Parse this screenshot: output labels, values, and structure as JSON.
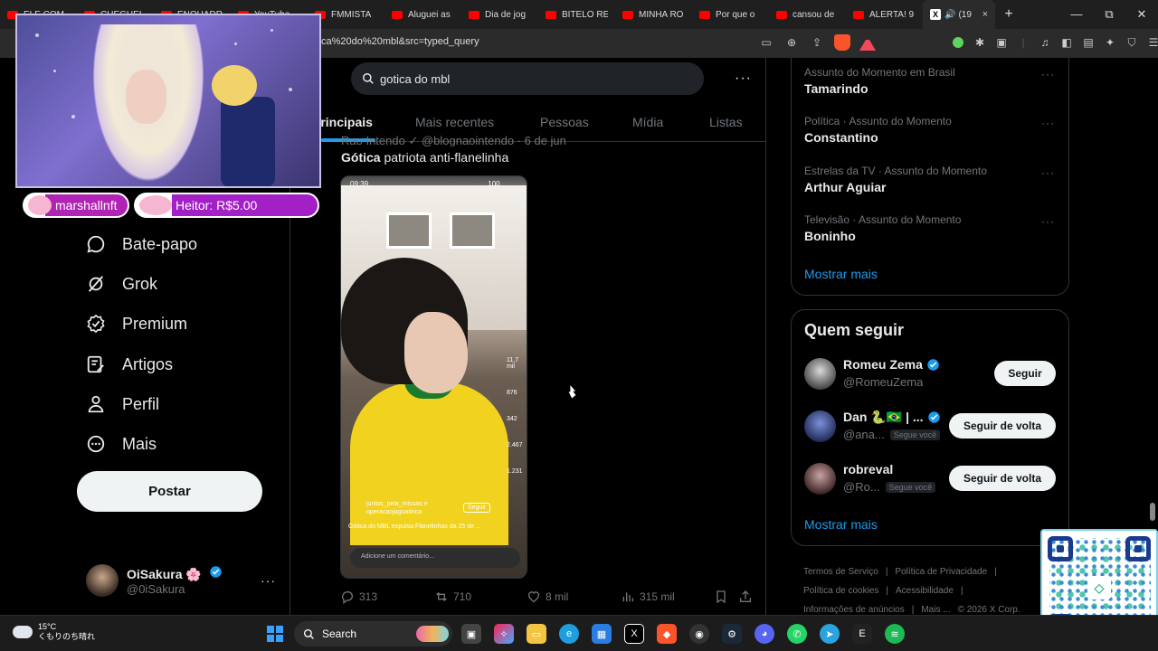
{
  "browser": {
    "tabs": [
      {
        "label": "ELE COM"
      },
      {
        "label": "CHEGUEI"
      },
      {
        "label": "ENQUADR"
      },
      {
        "label": "YouTube"
      },
      {
        "label": "FMMISTA"
      },
      {
        "label": "Aluguei as"
      },
      {
        "label": "Dia de jog"
      },
      {
        "label": "BITELO RE"
      },
      {
        "label": "MINHA RO"
      },
      {
        "label": "Por que o"
      },
      {
        "label": "cansou de"
      },
      {
        "label": "ALERTA! 9"
      }
    ],
    "active_tab": {
      "label": "(19",
      "close": "×"
    },
    "new_tab": "+",
    "window_controls": {
      "minimize": "—",
      "maximize": "⧉",
      "close": "✕"
    },
    "url": "ca%20do%20mbl&src=typed_query"
  },
  "stream_overlay": {
    "donation1": "marshallnft",
    "donation2": "Heitor: R$5.00"
  },
  "sidebar": {
    "items": [
      {
        "label": "Bate-papo",
        "icon": "chat-bubble-icon"
      },
      {
        "label": "Grok",
        "icon": "grok-icon"
      },
      {
        "label": "Premium",
        "icon": "premium-badge-icon"
      },
      {
        "label": "Artigos",
        "icon": "articles-icon"
      },
      {
        "label": "Perfil",
        "icon": "person-icon"
      },
      {
        "label": "Mais",
        "icon": "more-circle-icon"
      }
    ],
    "post_button": "Postar",
    "account": {
      "name": "OiSakura 🌸",
      "handle": "@0iSakura",
      "more": "···"
    }
  },
  "search": {
    "value": "gotica do mbl",
    "more": "···",
    "tabs": [
      {
        "label": "Principais"
      },
      {
        "label": "Mais recentes"
      },
      {
        "label": "Pessoas"
      },
      {
        "label": "Mídia"
      },
      {
        "label": "Listas"
      }
    ]
  },
  "tweet": {
    "header_partial": "Rao Intendo ✓ @blognaointendo · 6 de jun",
    "text_bold": "Gótica",
    "text_rest": " patriota anti-flanelinha",
    "media": {
      "status_time": "09:39",
      "battery": "100",
      "user": "juntos_pela_missao e operacaojaguatirica",
      "follow": "Seguir",
      "caption": "Gótica do MBL expulsa Flanelinhas da 25 de ...",
      "comment_placeholder": "Adicione um comentário...",
      "side_counts": [
        "11,7 mil",
        "876",
        "342",
        "2.467",
        "1.231"
      ]
    },
    "actions": {
      "replies": "313",
      "reposts": "710",
      "likes": "8 mil",
      "views": "315 mil"
    }
  },
  "trends": {
    "items": [
      {
        "meta": "Assunto do Momento em Brasil",
        "name": "Tamarindo"
      },
      {
        "meta": "Política · Assunto do Momento",
        "name": "Constantino"
      },
      {
        "meta": "Estrelas da TV · Assunto do Momento",
        "name": "Arthur Aguiar"
      },
      {
        "meta": "Televisão · Assunto do Momento",
        "name": "Boninho"
      }
    ],
    "show_more": "Mostrar mais"
  },
  "who_to_follow": {
    "title": "Quem seguir",
    "users": [
      {
        "name": "Romeu Zema",
        "handle": "@RomeuZema",
        "badge": "",
        "button": "Seguir"
      },
      {
        "name": "Dan 🐍🇧🇷 | ...",
        "handle": "@ana...",
        "badge": "Segue você",
        "button": "Seguir de volta"
      },
      {
        "name": "robreval",
        "handle": "@Ro...",
        "badge": "Segue você",
        "button": "Seguir de volta"
      }
    ],
    "show_more": "Mostrar mais"
  },
  "footer": {
    "links": [
      "Termos de Serviço",
      "|",
      "Política de Privacidade",
      "|",
      "Política de cookies",
      "|",
      "Acessibilidade",
      "|",
      "Informações de anúncios",
      "|",
      "Mais ...",
      "© 2026 X Corp."
    ]
  },
  "taskbar": {
    "temperature": "15°C",
    "weather": "くもりのち晴れ",
    "search_label": "Search"
  },
  "colors": {
    "accent": "#1d9bf0",
    "background": "#000000",
    "muted": "#71767b"
  }
}
